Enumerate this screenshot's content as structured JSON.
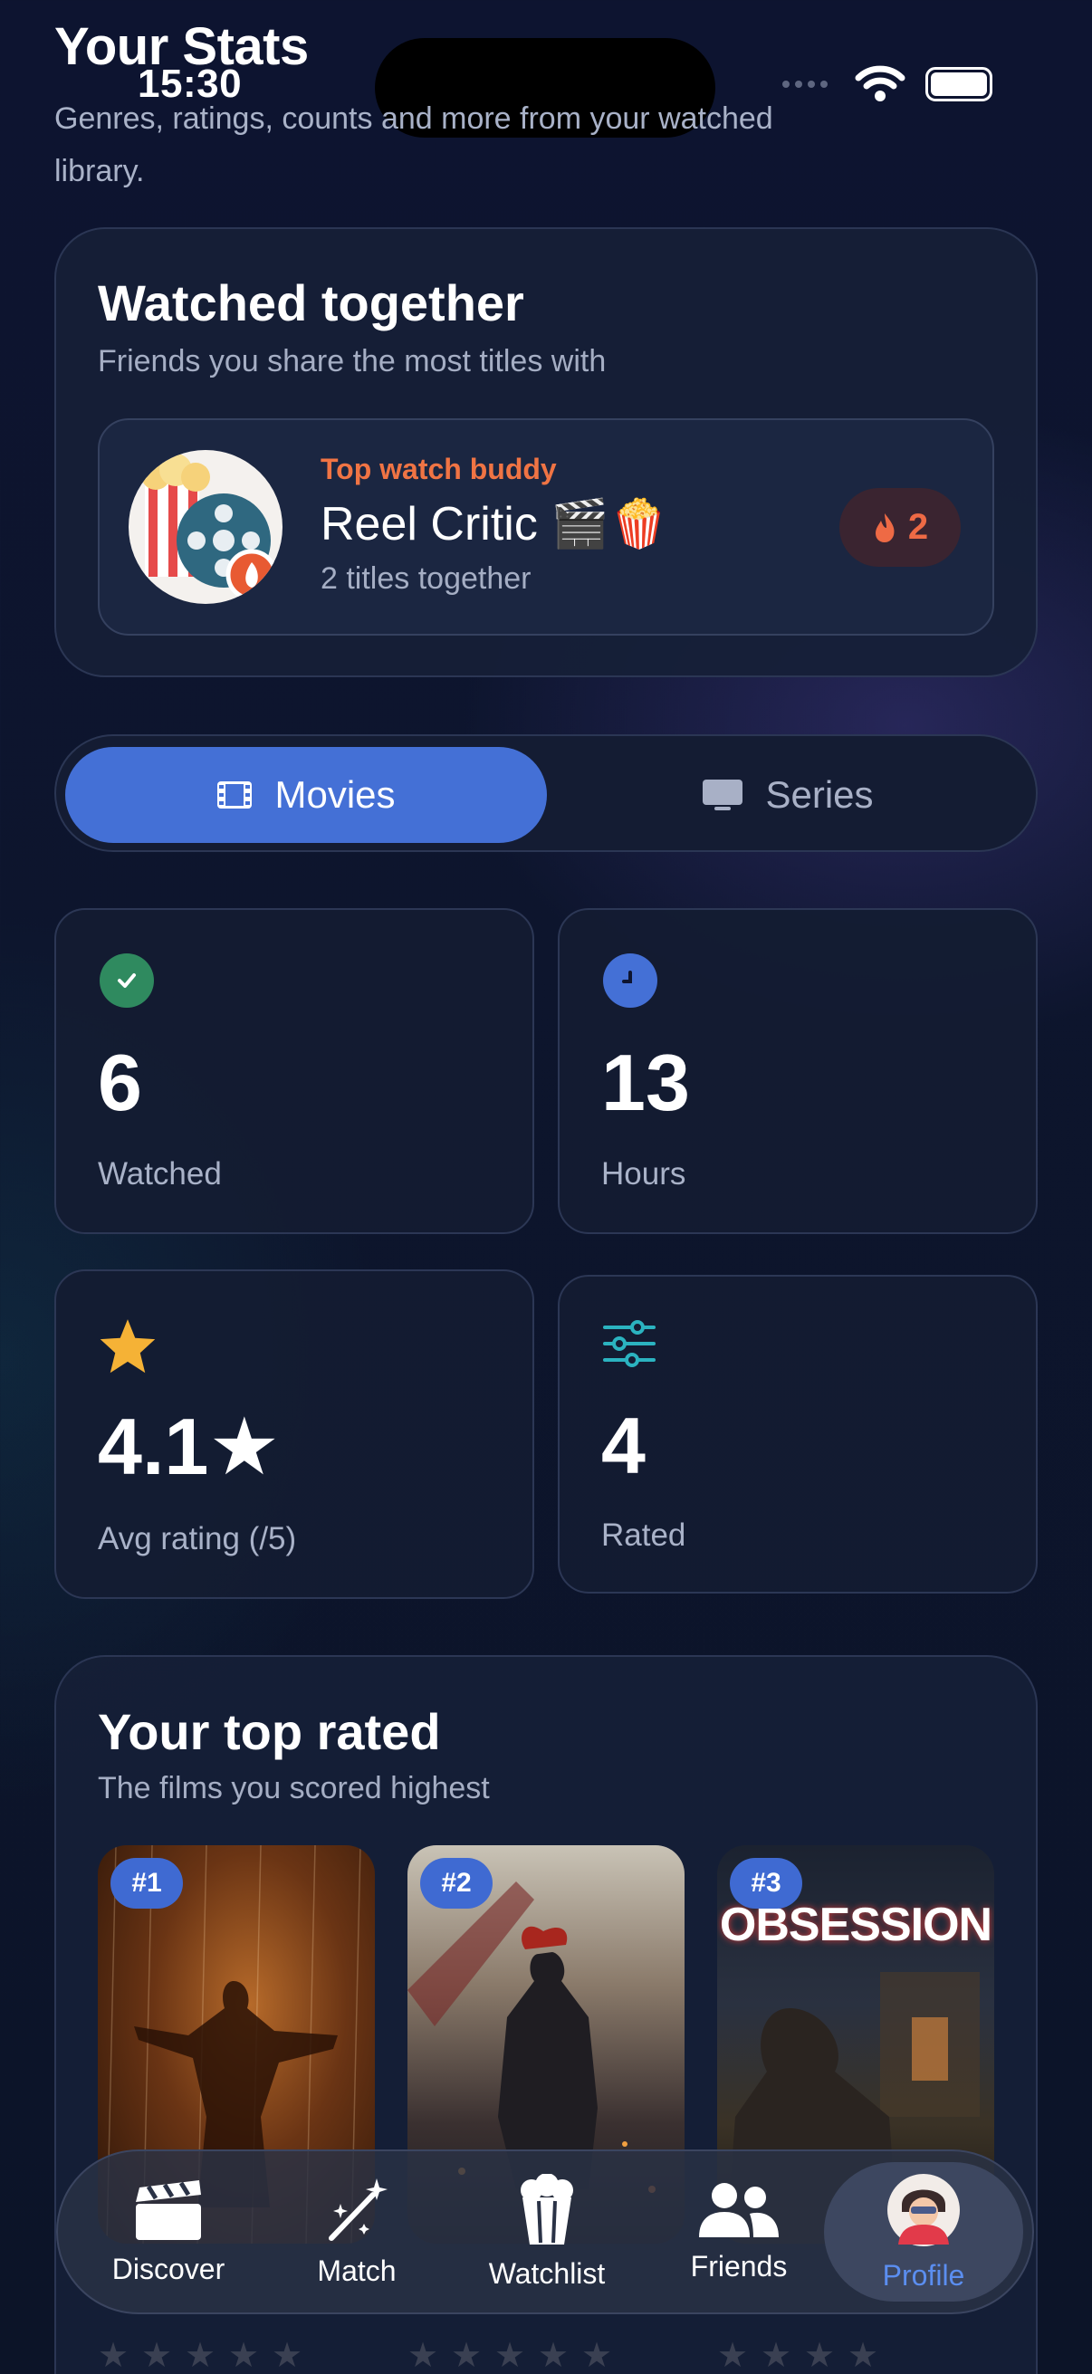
{
  "status": {
    "time": "15:30"
  },
  "header": {
    "title": "Your Stats",
    "subtitle": "Genres, ratings, counts and more from your watched library."
  },
  "together": {
    "title": "Watched together",
    "subtitle": "Friends you share the most titles with",
    "buddy_label": "Top watch buddy",
    "buddy_name": "Reel Critic 🎬🍿",
    "buddy_count_text": "2 titles together",
    "badge_value": "2",
    "badge_icon": "flame-icon"
  },
  "segment": {
    "options": [
      {
        "label": "Movies",
        "icon": "film-icon",
        "selected": true
      },
      {
        "label": "Series",
        "icon": "tv-icon",
        "selected": false
      }
    ]
  },
  "stats": [
    {
      "value": "6",
      "label": "Watched",
      "icon": "check-icon",
      "color": "#2f8a5f"
    },
    {
      "value": "13",
      "label": "Hours",
      "icon": "clock-icon",
      "color": "#4470d6"
    },
    {
      "value": "4.1★",
      "label": "Avg rating (/5)",
      "icon": "star-icon",
      "color": "#f5b236"
    },
    {
      "value": "4",
      "label": "Rated",
      "icon": "sliders-icon",
      "color": "#2bb3c0"
    }
  ],
  "top_rated": {
    "title": "Your top rated",
    "subtitle": "The films you scored highest",
    "items": [
      {
        "rank": "#1"
      },
      {
        "rank": "#2"
      },
      {
        "rank": "#3",
        "poster_text": "OBSESSION"
      }
    ]
  },
  "tabbar": {
    "tabs": [
      {
        "label": "Discover",
        "icon": "clapperboard-icon"
      },
      {
        "label": "Match",
        "icon": "magic-wand-icon"
      },
      {
        "label": "Watchlist",
        "icon": "popcorn-icon"
      },
      {
        "label": "Friends",
        "icon": "people-icon"
      },
      {
        "label": "Profile",
        "icon": "avatar-icon",
        "active": true
      }
    ]
  },
  "colors": {
    "accent": "#4470d6",
    "buddy_label": "#f07444",
    "profile_active": "#5b8ef0"
  }
}
